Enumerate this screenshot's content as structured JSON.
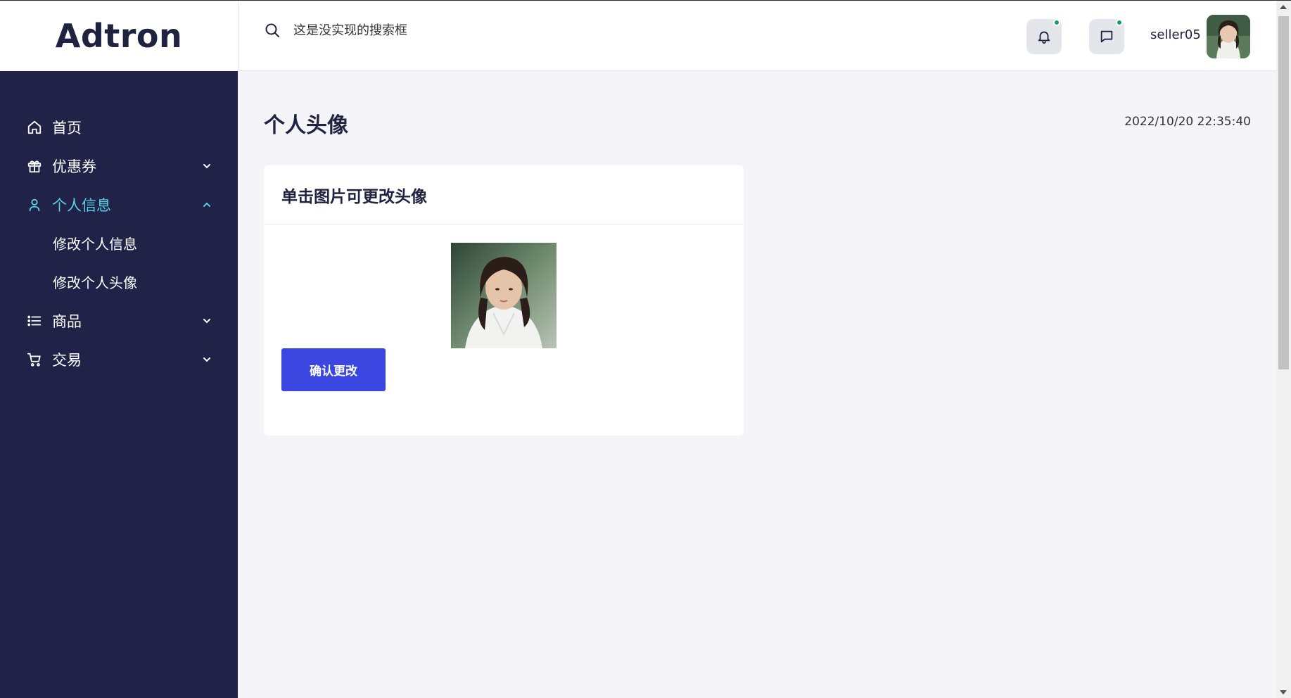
{
  "brand": {
    "name": "Adtron"
  },
  "search": {
    "placeholder": "这是没实现的搜索框"
  },
  "header": {
    "username": "seller05",
    "notification_dot_color": "#11a35a"
  },
  "sidebar": {
    "items": [
      {
        "label": "首页",
        "icon": "home-icon",
        "expandable": false
      },
      {
        "label": "优惠券",
        "icon": "gift-icon",
        "expandable": true,
        "expanded": false
      },
      {
        "label": "个人信息",
        "icon": "user-icon",
        "expandable": true,
        "expanded": true,
        "active": true,
        "children": [
          {
            "label": "修改个人信息"
          },
          {
            "label": "修改个人头像"
          }
        ]
      },
      {
        "label": "商品",
        "icon": "list-icon",
        "expandable": true,
        "expanded": false
      },
      {
        "label": "交易",
        "icon": "cart-icon",
        "expandable": true,
        "expanded": false
      }
    ]
  },
  "main": {
    "page_title": "个人头像",
    "timestamp": "2022/10/20 22:35:40",
    "card": {
      "title": "单击图片可更改头像",
      "confirm_label": "确认更改"
    }
  },
  "colors": {
    "sidebar_bg": "#202347",
    "active_accent": "#5ad2e6",
    "primary_button": "#3b46e1",
    "page_bg": "#f4f4f9"
  }
}
